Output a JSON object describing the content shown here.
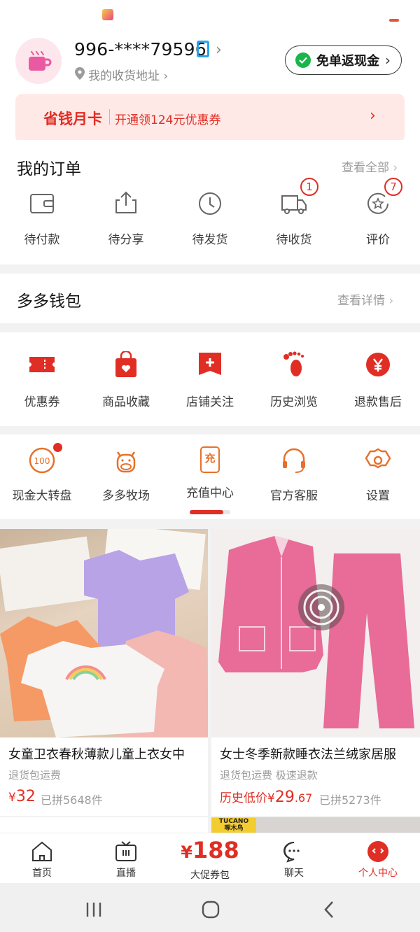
{
  "user": {
    "phone": "996-****79596",
    "address_label": "我的收货地址",
    "cashback_label": "免单返现金"
  },
  "savings_card": {
    "title": "省钱月卡",
    "subtitle": "开通领124元优惠券"
  },
  "orders": {
    "title": "我的订单",
    "view_all": "查看全部",
    "items": [
      {
        "label": "待付款",
        "icon": "wallet-icon"
      },
      {
        "label": "待分享",
        "icon": "share-icon"
      },
      {
        "label": "待发货",
        "icon": "clock-icon"
      },
      {
        "label": "待收货",
        "icon": "truck-icon",
        "badge": "1"
      },
      {
        "label": "评价",
        "icon": "review-icon",
        "badge": "7"
      }
    ]
  },
  "wallet": {
    "title": "多多钱包",
    "view_details": "查看详情"
  },
  "shortcuts": [
    {
      "label": "优惠券",
      "icon": "coupon-icon"
    },
    {
      "label": "商品收藏",
      "icon": "bag-heart-icon"
    },
    {
      "label": "店铺关注",
      "icon": "store-plus-icon"
    },
    {
      "label": "历史浏览",
      "icon": "footprint-icon"
    },
    {
      "label": "退款售后",
      "icon": "refund-yen-icon"
    }
  ],
  "services": [
    {
      "label": "现金大转盘",
      "icon": "wheel-100-icon"
    },
    {
      "label": "多多牧场",
      "icon": "cow-icon"
    },
    {
      "label": "充值中心",
      "icon": "recharge-icon",
      "glyph": "充"
    },
    {
      "label": "官方客服",
      "icon": "headset-icon"
    },
    {
      "label": "设置",
      "icon": "settings-icon"
    }
  ],
  "products": [
    {
      "title": "女童卫衣春秋薄款儿童上衣女中",
      "tags": "退货包运费",
      "price_prefix": "",
      "currency": "¥",
      "price": "32",
      "sold": "已拼5648件"
    },
    {
      "title": "女士冬季新款睡衣法兰绒家居服",
      "tags": "退货包运费  极速退款",
      "price_prefix": "历史低价",
      "currency": "¥",
      "price": "29",
      "price_cents": ".67",
      "sold": "已拼5273件"
    }
  ],
  "brand_peek": {
    "line1": "TUCANO",
    "line2": "啄木鸟"
  },
  "nav": [
    {
      "label": "首页",
      "icon": "home-icon"
    },
    {
      "label": "直播",
      "icon": "tv-icon"
    },
    {
      "label": "大促券包",
      "icon": "coupon-pack",
      "amount_currency": "¥",
      "amount": "188"
    },
    {
      "label": "聊天",
      "icon": "chat-icon"
    },
    {
      "label": "个人中心",
      "icon": "profile-icon",
      "active": true
    }
  ],
  "colors": {
    "accent": "#e02e24",
    "orange": "#e8702a",
    "green": "#18b54a"
  }
}
